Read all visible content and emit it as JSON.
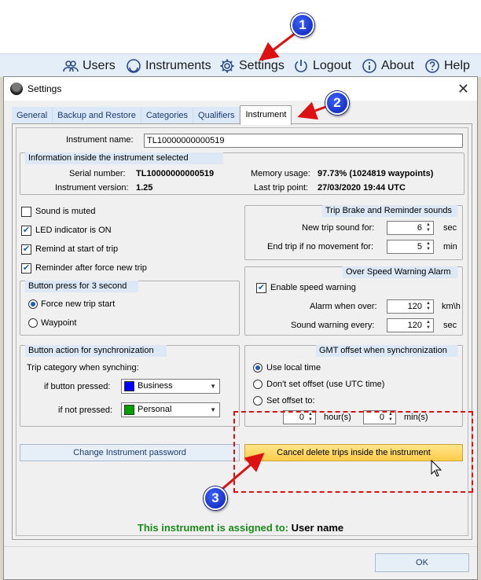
{
  "nav": {
    "users": "Users",
    "instruments": "Instruments",
    "settings": "Settings",
    "logout": "Logout",
    "about": "About",
    "help": "Help"
  },
  "window": {
    "title": "Settings",
    "close": "✕"
  },
  "tabs": [
    "General",
    "Backup and Restore",
    "Categories",
    "Qualifiers",
    "Instrument"
  ],
  "instrument": {
    "name_label": "Instrument name:",
    "name_value": "TL10000000000519"
  },
  "info": {
    "title": "Information inside the instrument selected",
    "serial_label": "Serial number:",
    "serial_value": "TL10000000000519",
    "version_label": "Instrument version:",
    "version_value": "1.25",
    "memory_label": "Memory usage:",
    "memory_value": "97.73% (1024819 waypoints)",
    "lasttrip_label": "Last trip point:",
    "lasttrip_value": "27/03/2020 19:44 UTC"
  },
  "checks": {
    "sound_muted": "Sound is muted",
    "led": "LED indicator is ON",
    "remind_start": "Remind at start of trip",
    "reminder_force": "Reminder after force new trip"
  },
  "button_press": {
    "title": "Button press for 3 second",
    "force_new": "Force new trip start",
    "waypoint": "Waypoint"
  },
  "trip_brake": {
    "title": "Trip Brake and Reminder sounds",
    "new_trip_label": "New trip sound for:",
    "new_trip_value": "6",
    "new_trip_unit": "sec",
    "end_trip_label": "End trip if no movement for:",
    "end_trip_value": "5",
    "end_trip_unit": "min"
  },
  "overspeed": {
    "title": "Over Speed Warning Alarm",
    "enable": "Enable speed warning",
    "alarm_label": "Alarm when over:",
    "alarm_value": "120",
    "alarm_unit": "km\\h",
    "sound_label": "Sound warning every:",
    "sound_value": "120",
    "sound_unit": "sec"
  },
  "sync_action": {
    "title": "Button action for synchronization",
    "category_label": "Trip category when synching:",
    "pressed_label": "if button pressed:",
    "pressed_value": "Business",
    "pressed_color": "#0000ff",
    "not_pressed_label": "if not pressed:",
    "not_pressed_value": "Personal",
    "not_pressed_color": "#00a000"
  },
  "gmt": {
    "title": "GMT offset when synchronization",
    "local": "Use local time",
    "no_offset": "Don't set offset (use UTC time)",
    "set_offset": "Set offset to:",
    "hours_value": "0",
    "hours_unit": "hour(s)",
    "mins_value": "0",
    "mins_unit": "min(s)"
  },
  "buttons": {
    "change_password": "Change Instrument password",
    "cancel_delete": "Cancel delete trips inside the instrument",
    "ok": "OK"
  },
  "assigned": {
    "label": "This instrument is assigned to:",
    "user": "User name",
    "label_color": "#1a8a1a"
  },
  "badges": [
    "1",
    "2",
    "3"
  ],
  "colors": {
    "accent_blue": "#1a5fb4",
    "group_header": "#dce8f6",
    "highlight_button": "#fdcc4a",
    "annotation_red": "#dd1111"
  }
}
